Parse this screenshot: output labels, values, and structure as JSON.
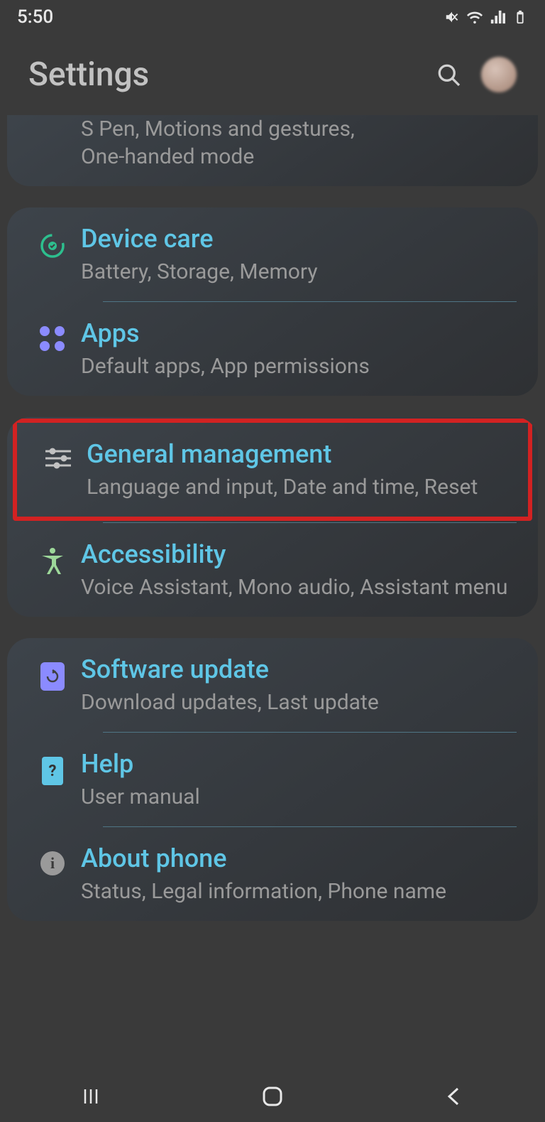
{
  "status": {
    "time": "5:50"
  },
  "header": {
    "title": "Settings"
  },
  "partial_item": {
    "title_fragment": "S Pen, Motions and gestures,",
    "sub_fragment": "One-handed mode"
  },
  "groups": [
    {
      "items": [
        {
          "id": "device-care",
          "title": "Device care",
          "sub": "Battery, Storage, Memory",
          "icon": "device-care-icon"
        },
        {
          "id": "apps",
          "title": "Apps",
          "sub": "Default apps, App permissions",
          "icon": "apps-icon"
        }
      ]
    },
    {
      "items": [
        {
          "id": "general-management",
          "title": "General management",
          "sub": "Language and input, Date and time, Reset",
          "icon": "sliders-icon",
          "highlighted": true
        },
        {
          "id": "accessibility",
          "title": "Accessibility",
          "sub": "Voice Assistant, Mono audio, Assistant menu",
          "icon": "accessibility-icon"
        }
      ]
    },
    {
      "items": [
        {
          "id": "software-update",
          "title": "Software update",
          "sub": "Download updates, Last update",
          "icon": "software-update-icon"
        },
        {
          "id": "help",
          "title": "Help",
          "sub": "User manual",
          "icon": "help-icon"
        },
        {
          "id": "about-phone",
          "title": "About phone",
          "sub": "Status, Legal information, Phone name",
          "icon": "info-icon"
        }
      ]
    }
  ],
  "colors": {
    "accent": "#5fc6e6",
    "highlight": "#d22222"
  }
}
